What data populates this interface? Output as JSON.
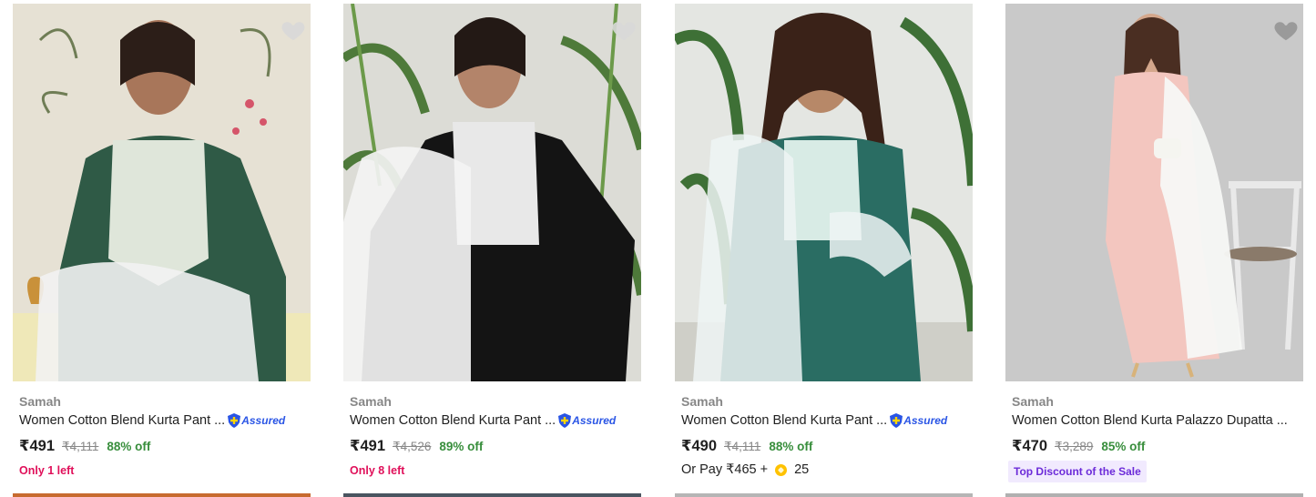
{
  "products": [
    {
      "brand": "Samah",
      "title": "Women Cotton Blend Kurta Pant ...",
      "assured": "Assured",
      "price": "₹491",
      "mrp": "₹4,111",
      "discount": "88% off",
      "note": "Only 1 left",
      "bar_color": "#c76b2f"
    },
    {
      "brand": "Samah",
      "title": "Women Cotton Blend Kurta Pant ...",
      "assured": "Assured",
      "price": "₹491",
      "mrp": "₹4,526",
      "discount": "89% off",
      "note": "Only 8 left",
      "bar_color": "#4a5560"
    },
    {
      "brand": "Samah",
      "title": "Women Cotton Blend Kurta Pant ...",
      "assured": "Assured",
      "price": "₹490",
      "mrp": "₹4,111",
      "discount": "88% off",
      "pay_prefix": "Or Pay ₹465 +",
      "coins": "25",
      "bar_color": "#b5b5b5"
    },
    {
      "brand": "Samah",
      "title": "Women Cotton Blend Kurta Palazzo Dupatta ...",
      "price": "₹470",
      "mrp": "₹3,289",
      "discount": "85% off",
      "badge": "Top Discount of the Sale",
      "bar_color": "#b0b0b0"
    }
  ],
  "icons": {
    "wishlist": "heart-icon",
    "assured": "shield-plus-icon",
    "coin": "supercoin-icon"
  },
  "colors": {
    "brand_text": "#878787",
    "price_green": "#388e3c",
    "stock_pink": "#e0105a",
    "assured_blue": "#2a55e5",
    "badge_purple": "#6c2bd9"
  }
}
